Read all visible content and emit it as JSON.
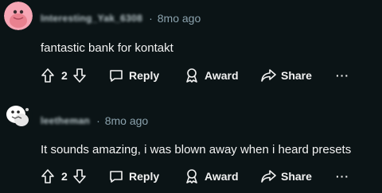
{
  "comments": [
    {
      "username": "Interesting_Yak_6308",
      "separator": "·",
      "time": "8mo ago",
      "text": "fantastic bank for kontakt",
      "score": "2",
      "reply_label": "Reply",
      "award_label": "Award",
      "share_label": "Share",
      "more_label": "···",
      "avatar_color": "#f6a6b5"
    },
    {
      "username": "leetheman",
      "separator": "·",
      "time": "8mo ago",
      "text": "It sounds amazing, i was blown away when i heard presets",
      "score": "2",
      "reply_label": "Reply",
      "award_label": "Award",
      "share_label": "Share",
      "more_label": "···",
      "avatar_color": "#ffffff"
    }
  ],
  "colors": {
    "background": "#0b1416",
    "text": "#f2f2f2",
    "meta": "#8ba2ad"
  },
  "icons": [
    "upvote-icon",
    "downvote-icon",
    "comment-icon",
    "award-icon",
    "share-icon",
    "more-icon"
  ]
}
